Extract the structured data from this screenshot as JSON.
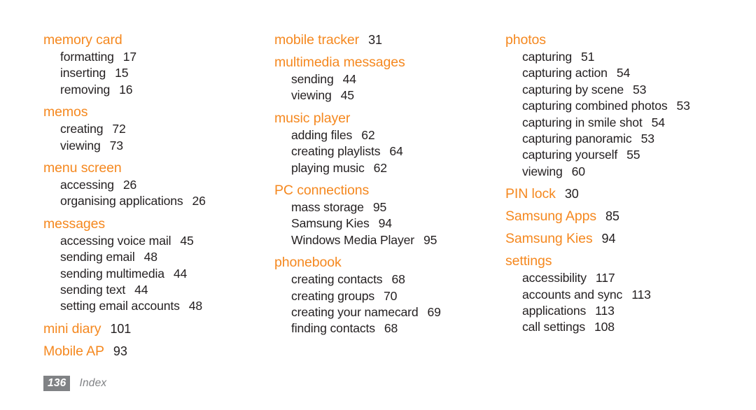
{
  "page": {
    "number": "136",
    "section_label": "Index",
    "heading_color": "#F5881F",
    "text_color": "#231f20",
    "footer_color": "#808285",
    "background": "#ffffff"
  },
  "columns": [
    {
      "groups": [
        {
          "term": "memory card",
          "page": "",
          "entries": [
            {
              "label": "formatting",
              "page": "17"
            },
            {
              "label": "inserting",
              "page": "15"
            },
            {
              "label": "removing",
              "page": "16"
            }
          ]
        },
        {
          "term": "memos",
          "page": "",
          "entries": [
            {
              "label": "creating",
              "page": "72"
            },
            {
              "label": "viewing",
              "page": "73"
            }
          ]
        },
        {
          "term": "menu screen",
          "page": "",
          "entries": [
            {
              "label": "accessing",
              "page": "26"
            },
            {
              "label": "organising applications",
              "page": "26"
            }
          ]
        },
        {
          "term": "messages",
          "page": "",
          "entries": [
            {
              "label": "accessing voice mail",
              "page": "45"
            },
            {
              "label": "sending email",
              "page": "48"
            },
            {
              "label": "sending multimedia",
              "page": "44"
            },
            {
              "label": "sending text",
              "page": "44"
            },
            {
              "label": "setting email accounts",
              "page": "48"
            }
          ]
        },
        {
          "term": "mini diary",
          "page": "101",
          "entries": []
        },
        {
          "term": "Mobile AP",
          "page": "93",
          "entries": []
        }
      ]
    },
    {
      "groups": [
        {
          "term": "mobile tracker",
          "page": "31",
          "entries": []
        },
        {
          "term": "multimedia messages",
          "page": "",
          "entries": [
            {
              "label": "sending",
              "page": "44"
            },
            {
              "label": "viewing",
              "page": "45"
            }
          ]
        },
        {
          "term": "music player",
          "page": "",
          "entries": [
            {
              "label": "adding files",
              "page": "62"
            },
            {
              "label": "creating playlists",
              "page": "64"
            },
            {
              "label": "playing music",
              "page": "62"
            }
          ]
        },
        {
          "term": "PC connections",
          "page": "",
          "entries": [
            {
              "label": "mass storage",
              "page": "95"
            },
            {
              "label": "Samsung Kies",
              "page": "94"
            },
            {
              "label": "Windows Media Player",
              "page": "95"
            }
          ]
        },
        {
          "term": "phonebook",
          "page": "",
          "entries": [
            {
              "label": "creating contacts",
              "page": "68"
            },
            {
              "label": "creating groups",
              "page": "70"
            },
            {
              "label": "creating your namecard",
              "page": "69"
            },
            {
              "label": "finding contacts",
              "page": "68"
            }
          ]
        }
      ]
    },
    {
      "groups": [
        {
          "term": "photos",
          "page": "",
          "entries": [
            {
              "label": "capturing",
              "page": "51"
            },
            {
              "label": "capturing action",
              "page": "54"
            },
            {
              "label": "capturing by scene",
              "page": "53"
            },
            {
              "label": "capturing combined photos",
              "page": "53"
            },
            {
              "label": "capturing in smile shot",
              "page": "54"
            },
            {
              "label": "capturing panoramic",
              "page": "53"
            },
            {
              "label": "capturing yourself",
              "page": "55"
            },
            {
              "label": "viewing",
              "page": "60"
            }
          ]
        },
        {
          "term": "PIN lock",
          "page": "30",
          "entries": []
        },
        {
          "term": "Samsung Apps",
          "page": "85",
          "entries": []
        },
        {
          "term": "Samsung Kies",
          "page": "94",
          "entries": []
        },
        {
          "term": "settings",
          "page": "",
          "entries": [
            {
              "label": "accessibility",
              "page": "117"
            },
            {
              "label": "accounts and sync",
              "page": "113"
            },
            {
              "label": "applications",
              "page": "113"
            },
            {
              "label": "call settings",
              "page": "108"
            }
          ]
        }
      ]
    }
  ]
}
